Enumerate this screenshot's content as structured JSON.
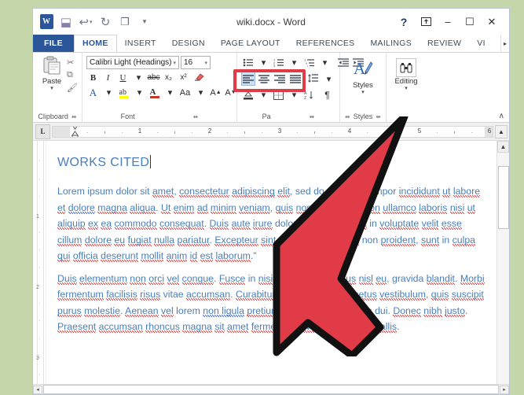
{
  "window": {
    "title": "wiki.docx - Word",
    "background_color": "#c5d6aa"
  },
  "quick_access": {
    "items": [
      {
        "name": "word-logo",
        "glyph": "W"
      },
      {
        "name": "save-icon",
        "glyph": "⬓"
      },
      {
        "name": "undo-icon",
        "glyph": "↩"
      },
      {
        "name": "redo-icon",
        "glyph": "↻"
      },
      {
        "name": "touch-mode-icon",
        "glyph": "❐"
      },
      {
        "name": "customize-qat-icon",
        "glyph": "▾"
      }
    ]
  },
  "window_controls": {
    "help": "?",
    "ribbon_display": "⬆",
    "minimize": "–",
    "maximize": "☐",
    "close": "✕"
  },
  "tabs": [
    {
      "label": "FILE",
      "state": "file"
    },
    {
      "label": "HOME",
      "state": "active"
    },
    {
      "label": "INSERT",
      "state": "normal"
    },
    {
      "label": "DESIGN",
      "state": "normal"
    },
    {
      "label": "PAGE LAYOUT",
      "state": "normal"
    },
    {
      "label": "REFERENCES",
      "state": "normal"
    },
    {
      "label": "MAILINGS",
      "state": "normal"
    },
    {
      "label": "REVIEW",
      "state": "normal"
    },
    {
      "label": "VI",
      "state": "cut"
    }
  ],
  "tab_overflow": "▸",
  "ribbon": {
    "clipboard": {
      "label": "Clipboard",
      "dialog_launcher": "⬌",
      "paste_label": "Paste",
      "paste_caret": "▾",
      "paste_icon": "📋",
      "cut_icon": "✂",
      "copy_icon": "⧉",
      "format_painter_icon": "🖌"
    },
    "font": {
      "label": "Font",
      "dialog_launcher": "⬌",
      "font_name": "Calibri Light (Headings)",
      "font_size": "16",
      "caret": "▾",
      "bold": "B",
      "italic": "I",
      "underline": "U",
      "strikethrough": "abc",
      "subscript": "x₂",
      "superscript": "x²",
      "clear_formatting": "🧹",
      "text_effects": "A",
      "highlight": "ab",
      "font_color": "A",
      "change_case": "Aa",
      "grow_font": "A",
      "shrink_font": "A",
      "font_color_swatch": "#c0392b",
      "highlight_swatch": "#ffff00",
      "text_effects_color": "#2b579a"
    },
    "paragraph": {
      "label": "Pa",
      "dialog_launcher": "⬌",
      "bullets": "bullet-list-icon",
      "numbering": "numbered-list-icon",
      "multilevel": "multilevel-list-icon",
      "decrease_indent": "⇤",
      "increase_indent": "⇥",
      "line_spacing": "↕",
      "sort": "↓",
      "show_marks": "¶",
      "shading": "▤",
      "borders": "⊞",
      "align_buttons": [
        {
          "name": "align-left-button",
          "selected": true
        },
        {
          "name": "align-center-button",
          "selected": false
        },
        {
          "name": "align-right-button",
          "selected": false
        },
        {
          "name": "justify-button",
          "selected": false
        }
      ],
      "highlight_box_color": "#e03b46"
    },
    "styles": {
      "label": "Styles",
      "button_label": "Styles",
      "caret": "▾",
      "icon": "A",
      "dialog_launcher": "⬌"
    },
    "editing": {
      "button_label": "Editing",
      "caret": "▾",
      "icon": "🔭"
    },
    "collapse": "∧"
  },
  "ruler": {
    "tab_selector": "L",
    "numbers": [
      "1",
      "2",
      "3",
      "4",
      "5",
      "6"
    ],
    "scroll_up": "▲",
    "vertical_numbers": [
      "1",
      "2",
      "3"
    ]
  },
  "document": {
    "heading": "WORKS CITED",
    "heading_color": "#4a7ebb",
    "body_color": "#4a7ebb",
    "paragraphs": [
      "Lorem ipsum dolor sit amet, consectetur adipiscing elit, sed do eiusmod tempor incididunt ut labore et dolore magna aliqua. Ut enim ad minim veniam, quis nostrud exercitation ullamco laboris nisi ut aliquip ex ea commodo consequat. Duis aute irure dolor in reprehenderit in voluptate velit esse cillum dolore eu fugiat nulla pariatur. Excepteur sint occaecat cupidatat non proident, sunt in culpa qui officia deserunt mollit anim id est laborum.\"",
      "Duis elementum non orci vel congue. Fusce in nisi ullamcorper, luctus nisl eu, gravida blandit. Morbi fermentum facilisis risus vitae accumsan. Curabitur tempus risus vel metus vestibulum, quis suscipit purus molestie. Aenean vel lorem non ligula pretium viverra. Sed in mattis dui. Donec nibh justo. Praesent accumsan rhoncus magna sit amet fermentum. Nunc a enim convallis."
    ]
  },
  "scrollbars": {
    "up_arrow": "▲",
    "down_arrow": "▼",
    "left_arrow": "◂",
    "right_arrow": "▸"
  },
  "cursor": {
    "name": "mouse-pointer",
    "fill": "#e03b46",
    "stroke": "#111111"
  }
}
